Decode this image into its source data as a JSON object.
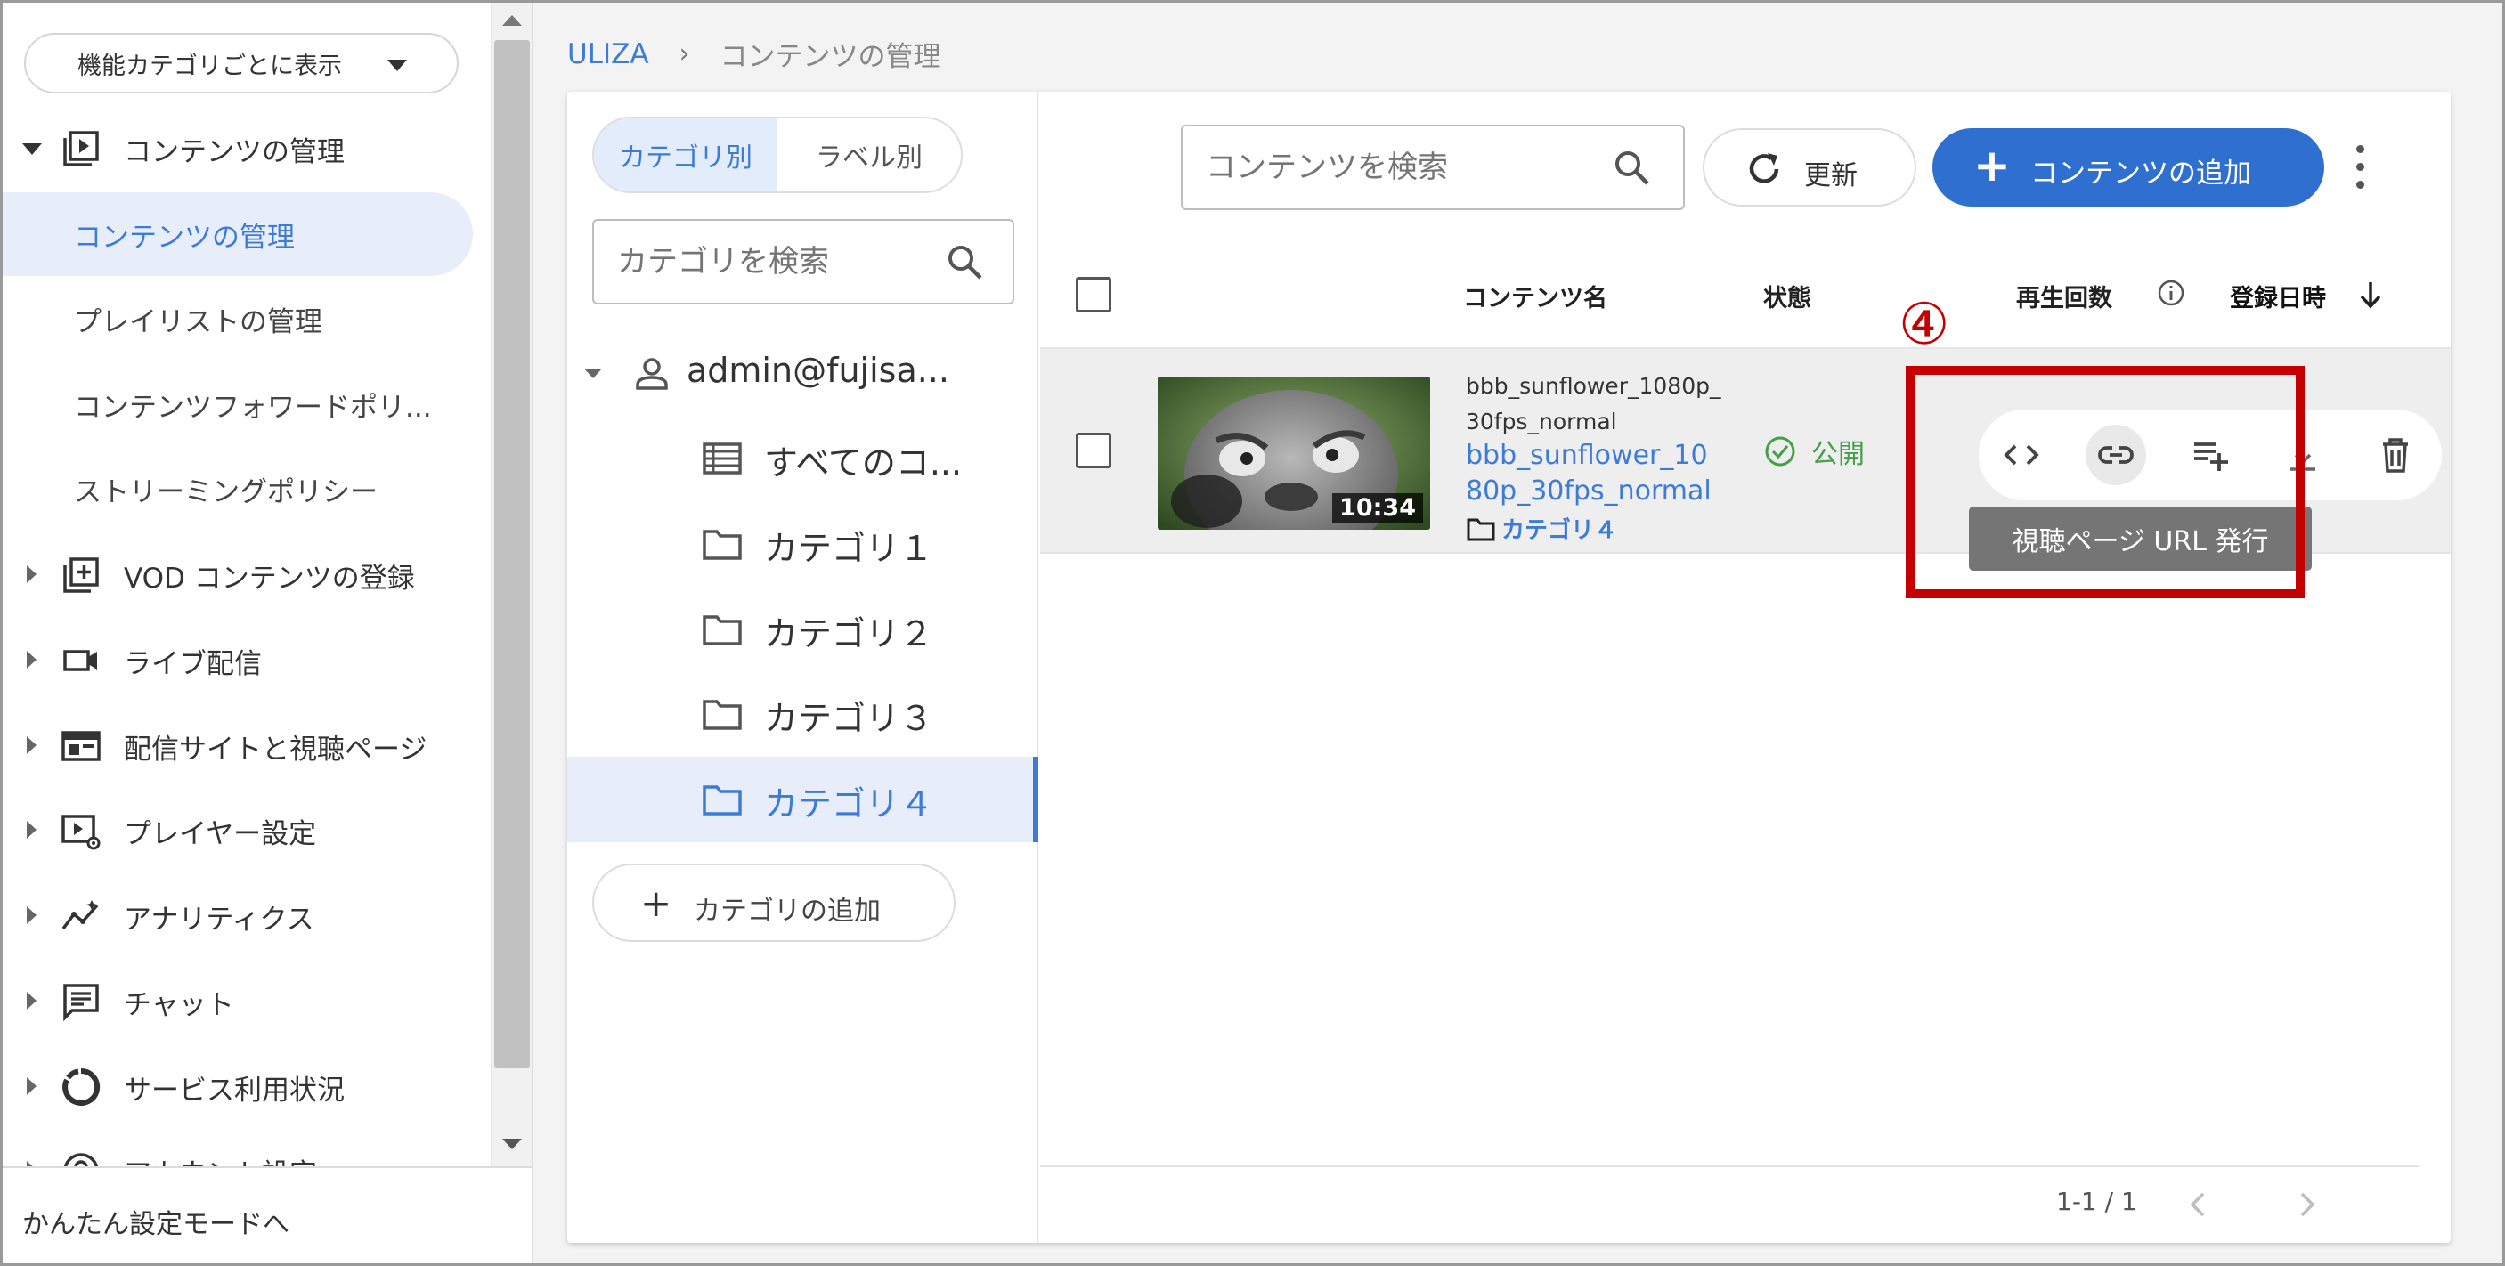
{
  "sidebar": {
    "view_select": "機能カテゴリごとに表示",
    "sections": [
      {
        "label": "コンテンツの管理",
        "icon": "play-box-icon",
        "expanded": true
      },
      {
        "label": "VOD コンテンツの登録",
        "icon": "add-library-icon"
      },
      {
        "label": "ライブ配信",
        "icon": "video-camera-icon"
      },
      {
        "label": "配信サイトと視聴ページ",
        "icon": "web-layout-icon"
      },
      {
        "label": "プレイヤー設定",
        "icon": "player-settings-icon"
      },
      {
        "label": "アナリティクス",
        "icon": "analytics-icon"
      },
      {
        "label": "チャット",
        "icon": "chat-icon"
      },
      {
        "label": "サービス利用状況",
        "icon": "usage-donut-icon"
      },
      {
        "label": "アカウント設定",
        "icon": "account-settings-icon"
      }
    ],
    "sub_items": [
      {
        "label": "コンテンツの管理",
        "active": true
      },
      {
        "label": "プレイリストの管理"
      },
      {
        "label": "コンテンツフォワードポリ..."
      },
      {
        "label": "ストリーミングポリシー"
      }
    ],
    "footer": "かんたん設定モードへ"
  },
  "breadcrumb": {
    "root": "ULIZA",
    "separator": "›",
    "current": "コンテンツの管理"
  },
  "category_panel": {
    "tabs": [
      {
        "label": "カテゴリ別",
        "active": true
      },
      {
        "label": "ラベル別"
      }
    ],
    "search_placeholder": "カテゴリを検索",
    "tree": [
      {
        "label": "admin@fujisa...",
        "icon": "person-icon"
      },
      {
        "label": "すべてのコ...",
        "icon": "list-icon"
      },
      {
        "label": "カテゴリ１",
        "icon": "folder-icon"
      },
      {
        "label": "カテゴリ２",
        "icon": "folder-icon"
      },
      {
        "label": "カテゴリ３",
        "icon": "folder-icon"
      },
      {
        "label": "カテゴリ４",
        "icon": "folder-icon",
        "active": true
      }
    ],
    "add_category": "カテゴリの追加"
  },
  "content_panel": {
    "search_placeholder": "コンテンツを検索",
    "refresh": "更新",
    "add_content": "コンテンツの追加",
    "columns": {
      "name": "コンテンツ名",
      "status": "状態",
      "plays": "再生回数",
      "registered": "登録日時"
    },
    "rows": [
      {
        "file_name": "bbb_sunflower_1080p_30fps_normal",
        "title": "bbb_sunflower_1080p_30fps_normal",
        "category": "カテゴリ４",
        "status": "公開",
        "duration": "10:34"
      }
    ],
    "row_actions": [
      "embed-code-icon",
      "link-icon",
      "playlist-add-icon",
      "download-icon",
      "delete-icon"
    ],
    "tooltip": "視聴ページ URL 発行",
    "pagination": "1-1 / 1"
  },
  "annotation": {
    "number": "④",
    "color": "#c40000"
  },
  "colors": {
    "accent": "#3d7bd6",
    "primary_button": "#2f6fd0",
    "status_public": "#43a047"
  }
}
